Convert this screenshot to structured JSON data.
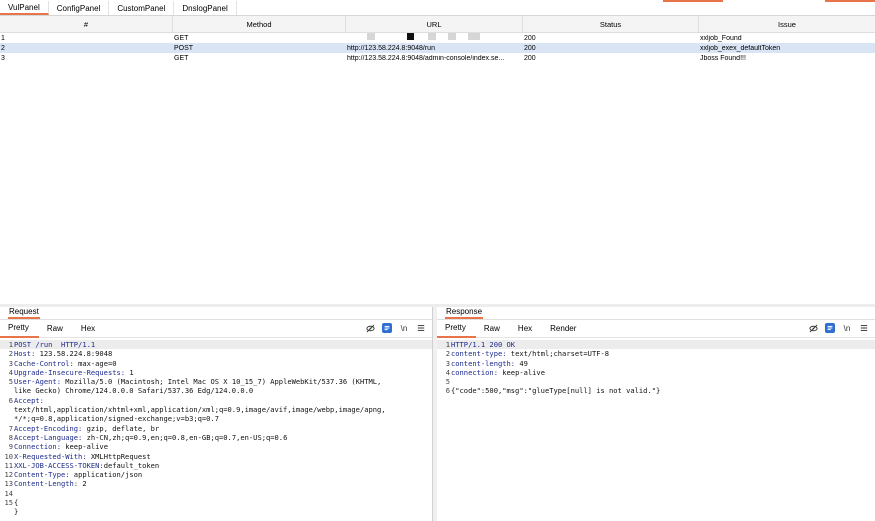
{
  "tabs": [
    "VulPanel",
    "ConfigPanel",
    "CustomPanel",
    "DnslogPanel"
  ],
  "table": {
    "headers": [
      "#",
      "Method",
      "URL",
      "Status",
      "Issue"
    ],
    "rows": [
      {
        "num": "1",
        "method": "GET",
        "url": "",
        "status": "200",
        "issue": "xxljob_Found"
      },
      {
        "num": "2",
        "method": "POST",
        "url": "http://123.58.224.8:9048/run",
        "status": "200",
        "issue": "xxljob_exex_defaultToken"
      },
      {
        "num": "3",
        "method": "GET",
        "url": "http://123.58.224.8:9048/admin-console/index.se...",
        "status": "200",
        "issue": "Jboss Found!!!"
      }
    ]
  },
  "request": {
    "title": "Request",
    "tabs": [
      "Pretty",
      "Raw",
      "Hex"
    ],
    "lines": [
      {
        "n": "1",
        "key": "POST /run  HTTP/1.1",
        "val": ""
      },
      {
        "n": "2",
        "key": "Host:",
        "val": " 123.58.224.8:9048"
      },
      {
        "n": "3",
        "key": "Cache-Control:",
        "val": " max-age=0"
      },
      {
        "n": "4",
        "key": "Upgrade-Insecure-Requests:",
        "val": " 1"
      },
      {
        "n": "5",
        "key": "User-Agent:",
        "val": " Mozilla/5.0 (Macintosh; Intel Mac OS X 10_15_7) AppleWebKit/537.36 (KHTML,"
      },
      {
        "n": "",
        "key": "",
        "val": "like Gecko) Chrome/124.0.0.0 Safari/537.36 Edg/124.0.0.0"
      },
      {
        "n": "6",
        "key": "Accept:",
        "val": ""
      },
      {
        "n": "",
        "key": "",
        "val": "text/html,application/xhtml+xml,application/xml;q=0.9,image/avif,image/webp,image/apng,"
      },
      {
        "n": "",
        "key": "",
        "val": "*/*;q=0.8,application/signed-exchange;v=b3;q=0.7"
      },
      {
        "n": "7",
        "key": "Accept-Encoding:",
        "val": " gzip, deflate, br"
      },
      {
        "n": "8",
        "key": "Accept-Language:",
        "val": " zh-CN,zh;q=0.9,en;q=0.8,en-GB;q=0.7,en-US;q=0.6"
      },
      {
        "n": "9",
        "key": "Connection:",
        "val": " keep-alive"
      },
      {
        "n": "10",
        "key": "X-Requested-With:",
        "val": " XMLHttpRequest"
      },
      {
        "n": "11",
        "key": "XXL-JOB-ACCESS-TOKEN:",
        "val": "default_token"
      },
      {
        "n": "12",
        "key": "Content-Type:",
        "val": " application/json"
      },
      {
        "n": "13",
        "key": "Content-Length:",
        "val": " 2"
      },
      {
        "n": "14",
        "key": "",
        "val": ""
      },
      {
        "n": "15",
        "key": "",
        "val": "{"
      },
      {
        "n": "",
        "key": "",
        "val": "}"
      }
    ]
  },
  "response": {
    "title": "Response",
    "tabs": [
      "Pretty",
      "Raw",
      "Hex",
      "Render"
    ],
    "lines": [
      {
        "n": "1",
        "key": "HTTP/1.1 200 OK",
        "val": ""
      },
      {
        "n": "2",
        "key": "content-type:",
        "val": " text/html;charset=UTF-8"
      },
      {
        "n": "3",
        "key": "content-length:",
        "val": " 49"
      },
      {
        "n": "4",
        "key": "connection:",
        "val": " keep-alive"
      },
      {
        "n": "5",
        "key": "",
        "val": ""
      },
      {
        "n": "6",
        "key": "",
        "val": "{\"code\":500,\"msg\":\"glueType[null] is not valid.\"}"
      }
    ]
  },
  "icons": {
    "hide": "eye-slash-icon",
    "wrap": "wrap-lines-icon",
    "newline": "newline-icon",
    "menu": "menu-icon"
  },
  "colors": {
    "accent": "#e8754a",
    "selected_row": "#d9e4f5",
    "key_text": "#1d2a8c"
  }
}
